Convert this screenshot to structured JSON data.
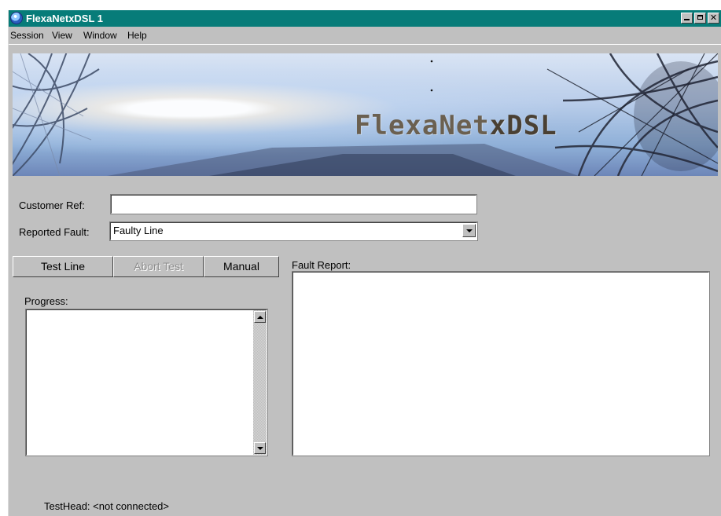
{
  "window": {
    "title": "FlexaNetxDSL 1",
    "app_icon": "globe-icon",
    "controls": [
      "minimize-icon",
      "maximize-icon",
      "close-icon"
    ],
    "title_color": "#077c79"
  },
  "menu": [
    "Session",
    "View",
    "Window",
    "Help"
  ],
  "banner": {
    "title_prefix": "FlexaNet",
    "title_suffix": "xDSL"
  },
  "form": {
    "customer_ref_label": "Customer Ref:",
    "customer_ref_value": "",
    "reported_fault_label": "Reported Fault:",
    "reported_fault_value": "Faulty Line"
  },
  "buttons": {
    "test_line": "Test Line",
    "abort_test": "Abort Test",
    "manual": "Manual"
  },
  "progress": {
    "label": "Progress:"
  },
  "fault_report": {
    "label": "Fault Report:"
  },
  "status": {
    "testhead": "TestHead: <not connected>"
  }
}
